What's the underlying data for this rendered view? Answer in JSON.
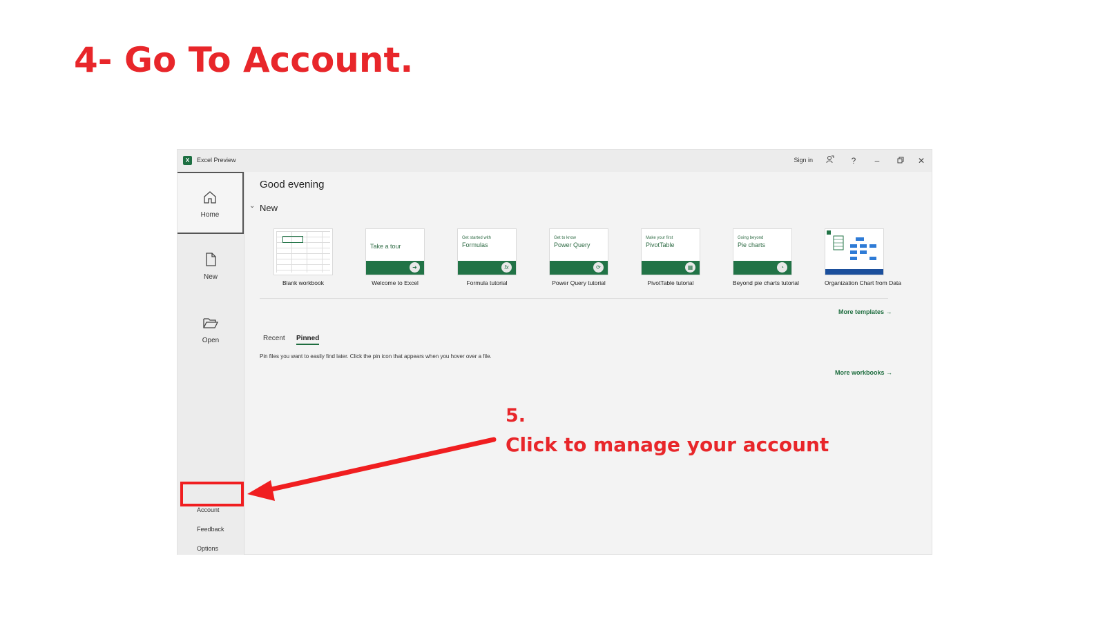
{
  "slide": {
    "heading": "4- Go To Account."
  },
  "window": {
    "app_title": "Excel Preview",
    "sign_in": "Sign in"
  },
  "sidebar": {
    "items": [
      {
        "label": "Home",
        "icon": "home-icon"
      },
      {
        "label": "New",
        "icon": "new-file-icon"
      },
      {
        "label": "Open",
        "icon": "folder-open-icon"
      }
    ],
    "bottom": {
      "account": "Account",
      "feedback": "Feedback",
      "options": "Options"
    }
  },
  "main": {
    "greeting": "Good evening",
    "new_section": "New",
    "templates": [
      {
        "label": "Blank workbook"
      },
      {
        "label": "Welcome to Excel",
        "thumb_small": "",
        "thumb_title": "Take a tour"
      },
      {
        "label": "Formula tutorial",
        "thumb_small": "Get started with",
        "thumb_title": "Formulas"
      },
      {
        "label": "Power Query tutorial",
        "thumb_small": "Get to know",
        "thumb_title": "Power Query"
      },
      {
        "label": "PivotTable tutorial",
        "thumb_small": "Make your first",
        "thumb_title": "PivotTable"
      },
      {
        "label": "Beyond pie charts tutorial",
        "thumb_small": "Going beyond",
        "thumb_title": "Pie charts"
      },
      {
        "label": "Organization Chart from Data"
      }
    ],
    "more_templates": "More templates",
    "tabs": [
      "Recent",
      "Pinned"
    ],
    "pinned_hint": "Pin files you want to easily find later. Click the pin icon that appears when you hover over a file.",
    "more_workbooks": "More workbooks"
  },
  "annotation": {
    "step": "5.",
    "text": "Click to manage your account"
  }
}
